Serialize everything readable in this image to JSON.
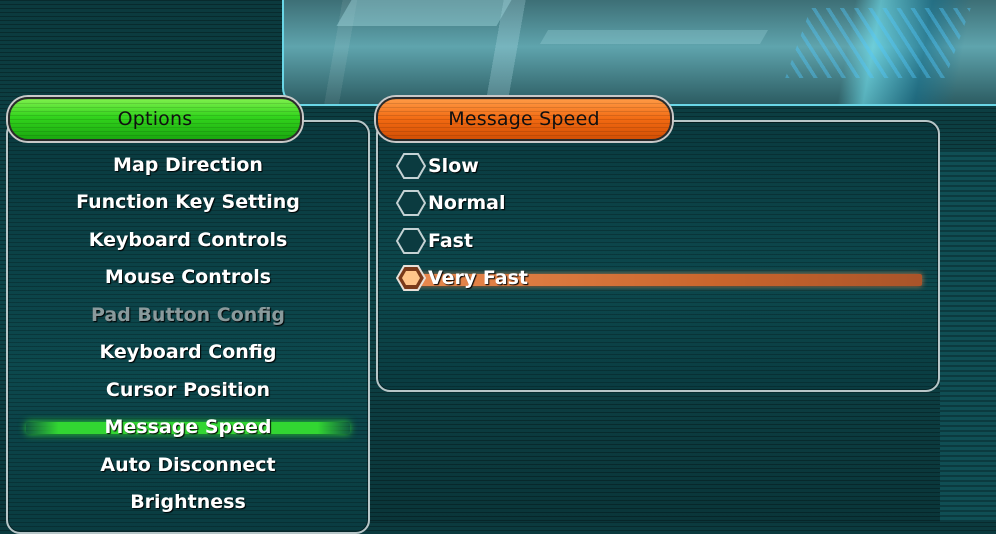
{
  "options_panel": {
    "title": "Options",
    "items": [
      {
        "label": "Map Direction",
        "state": "normal"
      },
      {
        "label": "Function Key Setting",
        "state": "normal"
      },
      {
        "label": "Keyboard Controls",
        "state": "normal"
      },
      {
        "label": "Mouse Controls",
        "state": "normal"
      },
      {
        "label": "Pad Button Config",
        "state": "disabled"
      },
      {
        "label": "Keyboard Config",
        "state": "normal"
      },
      {
        "label": "Cursor Position",
        "state": "normal"
      },
      {
        "label": "Message Speed",
        "state": "selected"
      },
      {
        "label": "Auto Disconnect",
        "state": "normal"
      },
      {
        "label": "Brightness",
        "state": "normal"
      }
    ]
  },
  "speed_panel": {
    "title": "Message Speed",
    "choices": [
      {
        "label": "Slow",
        "selected": false
      },
      {
        "label": "Normal",
        "selected": false
      },
      {
        "label": "Fast",
        "selected": false
      },
      {
        "label": "Very Fast",
        "selected": true
      }
    ]
  },
  "colors": {
    "options_accent": "#32d41c",
    "speed_accent": "#f26a12",
    "selected_row_green": "#32d632",
    "selected_row_orange": "#c9652c",
    "disabled_text": "#8a9a9c"
  },
  "icons": {
    "radio": "hexagon-radio-icon"
  }
}
